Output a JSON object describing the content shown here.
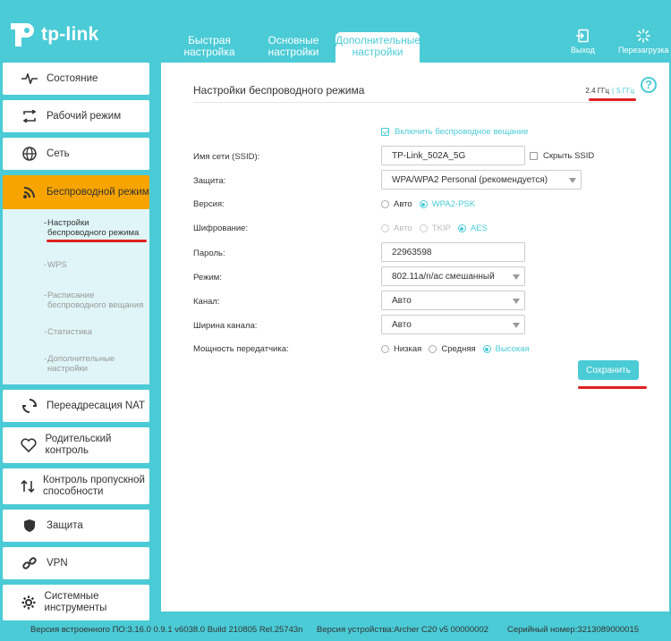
{
  "brand": {
    "logo_text": "tp-link"
  },
  "top_tabs": [
    {
      "label": "Быстрая настройка",
      "active": false
    },
    {
      "label": "Основные настройки",
      "active": false
    },
    {
      "label": "Дополнительные настройки",
      "active": true
    }
  ],
  "header_buttons": {
    "logout": "Выход",
    "reboot": "Перезагрузка"
  },
  "sidebar": {
    "items": [
      {
        "label": "Состояние",
        "icon": "pulse-icon"
      },
      {
        "label": "Рабочий режим",
        "icon": "mode-arrows-icon"
      },
      {
        "label": "Сеть",
        "icon": "globe-icon"
      },
      {
        "label": "Беспроводной режим",
        "icon": "wifi-icon",
        "active": true
      },
      {
        "label": "Переадресация NAT",
        "icon": "nat-icon"
      },
      {
        "label": "Родительский контроль",
        "icon": "parental-heart-icon"
      },
      {
        "label": "Контроль пропускной способности",
        "icon": "bandwidth-arrows-icon"
      },
      {
        "label": "Защита",
        "icon": "shield-icon"
      },
      {
        "label": "VPN",
        "icon": "vpn-link-icon"
      },
      {
        "label": "Системные инструменты",
        "icon": "gear-icon"
      }
    ],
    "sub_items": [
      {
        "label": "Настройки беспроводного режима",
        "selected": true
      },
      {
        "label": "WPS"
      },
      {
        "label": "Расписание беспроводного вещания"
      },
      {
        "label": "Статистика"
      },
      {
        "label": "Дополнительные настройки"
      }
    ]
  },
  "panel": {
    "title": "Настройки беспроводного режима",
    "freq_24": "2.4 ГГц",
    "freq_sep": "|",
    "freq_5": "5 ГГц",
    "help": "?"
  },
  "form": {
    "enable_broadcast": "Включить беспроводное вещание",
    "ssid_label": "Имя сети (SSID):",
    "ssid_value": "TP-Link_502A_5G",
    "hide_ssid": "Скрыть SSID",
    "security_label": "Защита:",
    "security_value": "WPA/WPA2 Personal (рекомендуется)",
    "version_label": "Версия:",
    "version_options": [
      "Авто",
      "WPA2-PSK"
    ],
    "encryption_label": "Шифрование:",
    "encryption_options": [
      "Авто",
      "TKIP",
      "AES"
    ],
    "password_label": "Пароль:",
    "password_value": "22963598",
    "mode_label": "Режим:",
    "mode_value": "802.11a/n/ac смешанный",
    "channel_label": "Канал:",
    "channel_value": "Авто",
    "width_label": "Ширина канала:",
    "width_value": "Авто",
    "power_label": "Мощность передатчика:",
    "power_options": [
      "Низкая",
      "Средняя",
      "Высокая"
    ],
    "save": "Сохранить"
  },
  "footer": {
    "firmware": "Версия встроенного ПО:3.16.0 0.9.1 v6038.0 Build 210805 Rel.25743n",
    "hardware": "Версия устройства:Archer C20 v5 00000002",
    "serial": "Серийный номер:3213089000015"
  },
  "colors": {
    "accent": "#4acbd6",
    "active_menu": "#f7a400",
    "highlight_mark": "#e02020"
  }
}
